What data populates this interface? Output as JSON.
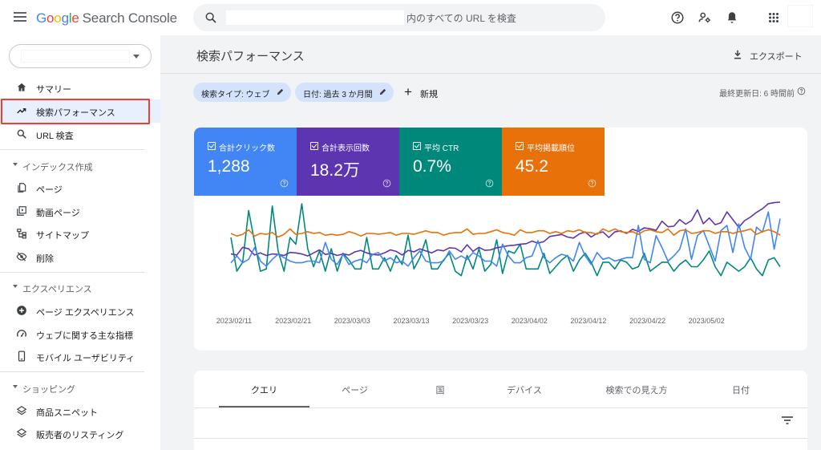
{
  "app": {
    "logo_google": "Google",
    "logo_product": "Search Console"
  },
  "search": {
    "placeholder": "内のすべての URL を検査"
  },
  "sidebar": {
    "items": [
      {
        "label": "サマリー",
        "icon": "home-icon"
      },
      {
        "label": "検索パフォーマンス",
        "icon": "trending-up-icon",
        "active": true
      },
      {
        "label": "URL 検査",
        "icon": "search-icon"
      }
    ],
    "sections": [
      {
        "title": "インデックス作成",
        "items": [
          {
            "label": "ページ",
            "icon": "pages-icon"
          },
          {
            "label": "動画ページ",
            "icon": "video-pages-icon"
          },
          {
            "label": "サイトマップ",
            "icon": "sitemap-icon"
          },
          {
            "label": "削除",
            "icon": "visibility-off-icon"
          }
        ]
      },
      {
        "title": "エクスペリエンス",
        "items": [
          {
            "label": "ページ エクスペリエンス",
            "icon": "add-circle-icon"
          },
          {
            "label": "ウェブに関する主な指標",
            "icon": "speed-icon"
          },
          {
            "label": "モバイル ユーザビリティ",
            "icon": "smartphone-icon"
          }
        ]
      },
      {
        "title": "ショッピング",
        "items": [
          {
            "label": "商品スニペット",
            "icon": "layers-icon"
          },
          {
            "label": "販売者のリスティング",
            "icon": "layers-icon"
          }
        ]
      }
    ]
  },
  "main": {
    "title": "検索パフォーマンス",
    "export_label": "エクスポート",
    "filters": [
      {
        "label": "検索タイプ: ウェブ"
      },
      {
        "label": "日付: 過去 3 か月間"
      }
    ],
    "new_label": "新規",
    "last_updated": "最終更新日: 6 時間前"
  },
  "metrics": [
    {
      "label": "合計クリック数",
      "value": "1,288",
      "color": "#4285f4"
    },
    {
      "label": "合計表示回数",
      "value": "18.2万",
      "color": "#5e35b1"
    },
    {
      "label": "平均 CTR",
      "value": "0.7%",
      "color": "#00897b"
    },
    {
      "label": "平均掲載順位",
      "value": "45.2",
      "color": "#e8710a"
    }
  ],
  "chart_data": {
    "type": "line",
    "x_tick_labels": [
      "2023/02/11",
      "2023/02/21",
      "2023/03/03",
      "2023/03/13",
      "2023/03/23",
      "2023/04/02",
      "2023/04/12",
      "2023/04/22",
      "2023/05/02"
    ],
    "x_start": "2023/02/11",
    "days": 94,
    "axes_shown": false,
    "grid": false,
    "series": [
      {
        "name": "合計表示回数",
        "color": "#5e35b1",
        "values": [
          82,
          80,
          95,
          92,
          80,
          84,
          79,
          82,
          81,
          79,
          85,
          84,
          82,
          78,
          84,
          90,
          81,
          83,
          79,
          82,
          80,
          86,
          89,
          84,
          81,
          80,
          84,
          90,
          87,
          80,
          89,
          86,
          92,
          88,
          84,
          90,
          88,
          94,
          93,
          86,
          100,
          87,
          95,
          89,
          90,
          94,
          96,
          98,
          99,
          101,
          102,
          107,
          103,
          106,
          116,
          118,
          120,
          115,
          113,
          121,
          125,
          115,
          122,
          125,
          114,
          125,
          127,
          122,
          130,
          126,
          133,
          131,
          128,
          146,
          135,
          136,
          149,
          140,
          147,
          168,
          141,
          152,
          139,
          143,
          164,
          149,
          134,
          147,
          154,
          163,
          170,
          180,
          182,
          183
        ]
      },
      {
        "name": "合計クリック数",
        "color": "#4285f4",
        "values": [
          2,
          6,
          2,
          4,
          11,
          3,
          0,
          4,
          7,
          5,
          3,
          2,
          2,
          3,
          3,
          2,
          14,
          4,
          1,
          7,
          1,
          3,
          4,
          2,
          7,
          8,
          3,
          5,
          2,
          3,
          0,
          5,
          9,
          3,
          2,
          2,
          3,
          9,
          4,
          6,
          4,
          8,
          6,
          3,
          3,
          0,
          13,
          6,
          2,
          2,
          5,
          6,
          15,
          5,
          2,
          5,
          7,
          6,
          3,
          14,
          6,
          1,
          8,
          4,
          5,
          3,
          4,
          5,
          5,
          24,
          4,
          2,
          18,
          11,
          3,
          6,
          10,
          22,
          4,
          18,
          21,
          12,
          3,
          21,
          24,
          8,
          25,
          11,
          4,
          23,
          20,
          32,
          10,
          28
        ]
      },
      {
        "name": "平均 CTR",
        "color": "#00897b",
        "values": [
          2,
          0.5,
          0.9,
          3.2,
          1.8,
          0.5,
          0.6,
          3.4,
          1.4,
          0.5,
          2.0,
          1.7,
          3.5,
          1.5,
          0.7,
          1.4,
          0.5,
          1.5,
          0.5,
          1.3,
          1.0,
          0.6,
          0.6,
          2.0,
          0.6,
          0.6,
          1.1,
          0.5,
          1.2,
          0.8,
          2.1,
          0.6,
          1.1,
          1.9,
          0.6,
          0.6,
          1.0,
          1.3,
          0.5,
          0.3,
          1.2,
          0.6,
          1.5,
          0.5,
          0.8,
          1.9,
          0.4,
          1.4,
          1.3,
          1.7,
          0.6,
          0.6,
          0.6,
          1.3,
          0.4,
          0.7,
          1.0,
          1.2,
          0.5,
          1.0,
          1.3,
          0.9,
          0.3,
          0.9,
          0.9,
          0.6,
          1.0,
          0.9,
          0.6,
          0.7,
          1.3,
          0.5,
          0.7,
          0.9,
          0.9,
          0.5,
          0.8,
          1.0,
          0.7,
          0.7,
          1.0,
          1.4,
          0.7,
          0.3,
          0.9,
          0.7,
          0.5,
          0.7,
          1.1,
          0.6,
          0.3,
          1.0,
          1.1,
          0.7
        ]
      },
      {
        "name": "平均掲載順位",
        "color": "#e8710a",
        "values": [
          45,
          48,
          46,
          41,
          48,
          45,
          46,
          44,
          49,
          46,
          40,
          46,
          45,
          43,
          45,
          44,
          47,
          46,
          47,
          46,
          43,
          45,
          48,
          45,
          45,
          46,
          45,
          44,
          47,
          45,
          45,
          46,
          44,
          42,
          44,
          44,
          47,
          45,
          44,
          44,
          40,
          46,
          45,
          45,
          43,
          41,
          44,
          45,
          47,
          41,
          44,
          44,
          42,
          42,
          45,
          43,
          45,
          42,
          43,
          41,
          44,
          44,
          46,
          40,
          43,
          40,
          43,
          44,
          43,
          46,
          42,
          41,
          43,
          44,
          40,
          47,
          42,
          41,
          45,
          44,
          42,
          42,
          45,
          43,
          43,
          45,
          43,
          42,
          40,
          46,
          43,
          41,
          43,
          47
        ]
      }
    ]
  },
  "tabs": [
    {
      "label": "クエリ",
      "active": true
    },
    {
      "label": "ページ"
    },
    {
      "label": "国"
    },
    {
      "label": "デバイス"
    },
    {
      "label": "検索での見え方"
    },
    {
      "label": "日付"
    }
  ]
}
